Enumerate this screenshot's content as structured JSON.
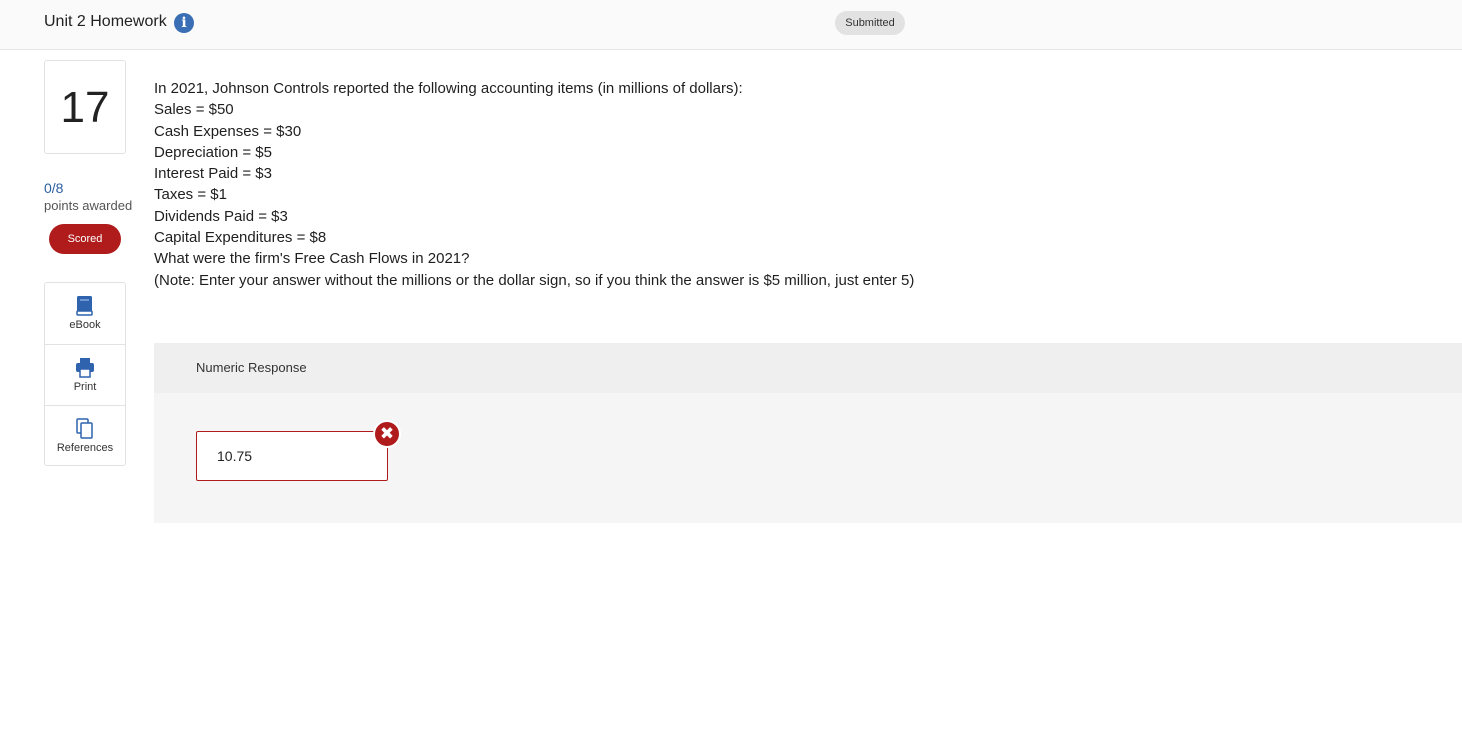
{
  "header": {
    "title": "Unit 2 Homework",
    "info_icon": "info-icon",
    "status": "Submitted"
  },
  "question_panel": {
    "number": "17",
    "points": "0/8",
    "points_label": "points awarded",
    "badge": "Scored",
    "tools": [
      {
        "label": "eBook",
        "icon": "book-icon"
      },
      {
        "label": "Print",
        "icon": "printer-icon"
      },
      {
        "label": "References",
        "icon": "copy-icon"
      }
    ]
  },
  "question": {
    "lines": [
      "In 2021, Johnson Controls reported the following accounting items (in millions of dollars):",
      "Sales = $50",
      "Cash Expenses = $30",
      "Depreciation = $5",
      "Interest Paid = $3",
      "Taxes = $1",
      "Dividends Paid = $3",
      "Capital Expenditures = $8",
      "What were the firm's Free Cash Flows in 2021?",
      "(Note: Enter your answer without the millions or the dollar sign, so if you think the answer is $5 million, just enter 5)"
    ]
  },
  "response": {
    "title": "Numeric Response",
    "answer": "10.75",
    "result_icon": "incorrect-x-icon",
    "result_glyph": "✖"
  },
  "colors": {
    "accent_blue": "#3a6fb5",
    "error_red": "#b01c1c"
  }
}
